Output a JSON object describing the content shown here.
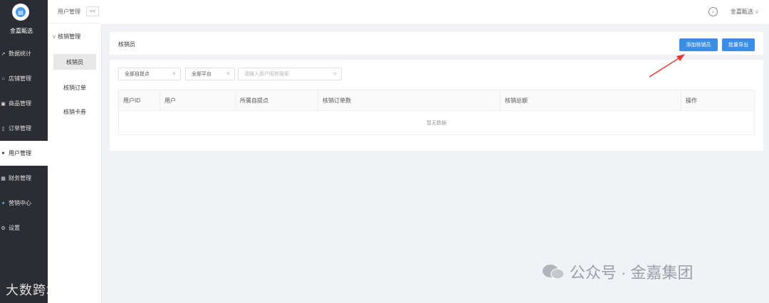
{
  "brand": {
    "name": "金嘉甄选"
  },
  "sidebar": {
    "items": [
      {
        "label": "数据统计",
        "icon": "chart-icon"
      },
      {
        "label": "店铺管理",
        "icon": "store-icon"
      },
      {
        "label": "商品管理",
        "icon": "goods-icon"
      },
      {
        "label": "订单管理",
        "icon": "order-icon"
      },
      {
        "label": "用户管理",
        "icon": "user-icon",
        "active": true
      },
      {
        "label": "财务管理",
        "icon": "finance-icon"
      },
      {
        "label": "营销中心",
        "icon": "marketing-icon"
      },
      {
        "label": "设置",
        "icon": "settings-icon"
      }
    ]
  },
  "subnav": {
    "header": "用户管理",
    "collapse": "<<",
    "group": "核销管理",
    "items": [
      {
        "label": "核销员",
        "active": true
      },
      {
        "label": "核销订单"
      },
      {
        "label": "核销卡券"
      }
    ]
  },
  "topbar": {
    "store": "金嘉甄选"
  },
  "panel": {
    "title": "核销员",
    "add_button": "添加核销员",
    "export_button": "批量导出"
  },
  "filters": {
    "pickup_select": "全部自提点",
    "platform_select": "全部平台",
    "search_placeholder": "请输入用户昵称搜索"
  },
  "table": {
    "columns": [
      "用户ID",
      "用户",
      "所属自提点",
      "核销订单数",
      "核销总额",
      "操作"
    ],
    "empty_text": "暂无数据"
  },
  "watermarks": {
    "left": "大数跨境",
    "right": "公众号 · 金嘉集团"
  },
  "colors": {
    "sidebar_bg": "#2b2d33",
    "primary": "#3a8ee6",
    "arrow": "#e53935"
  }
}
